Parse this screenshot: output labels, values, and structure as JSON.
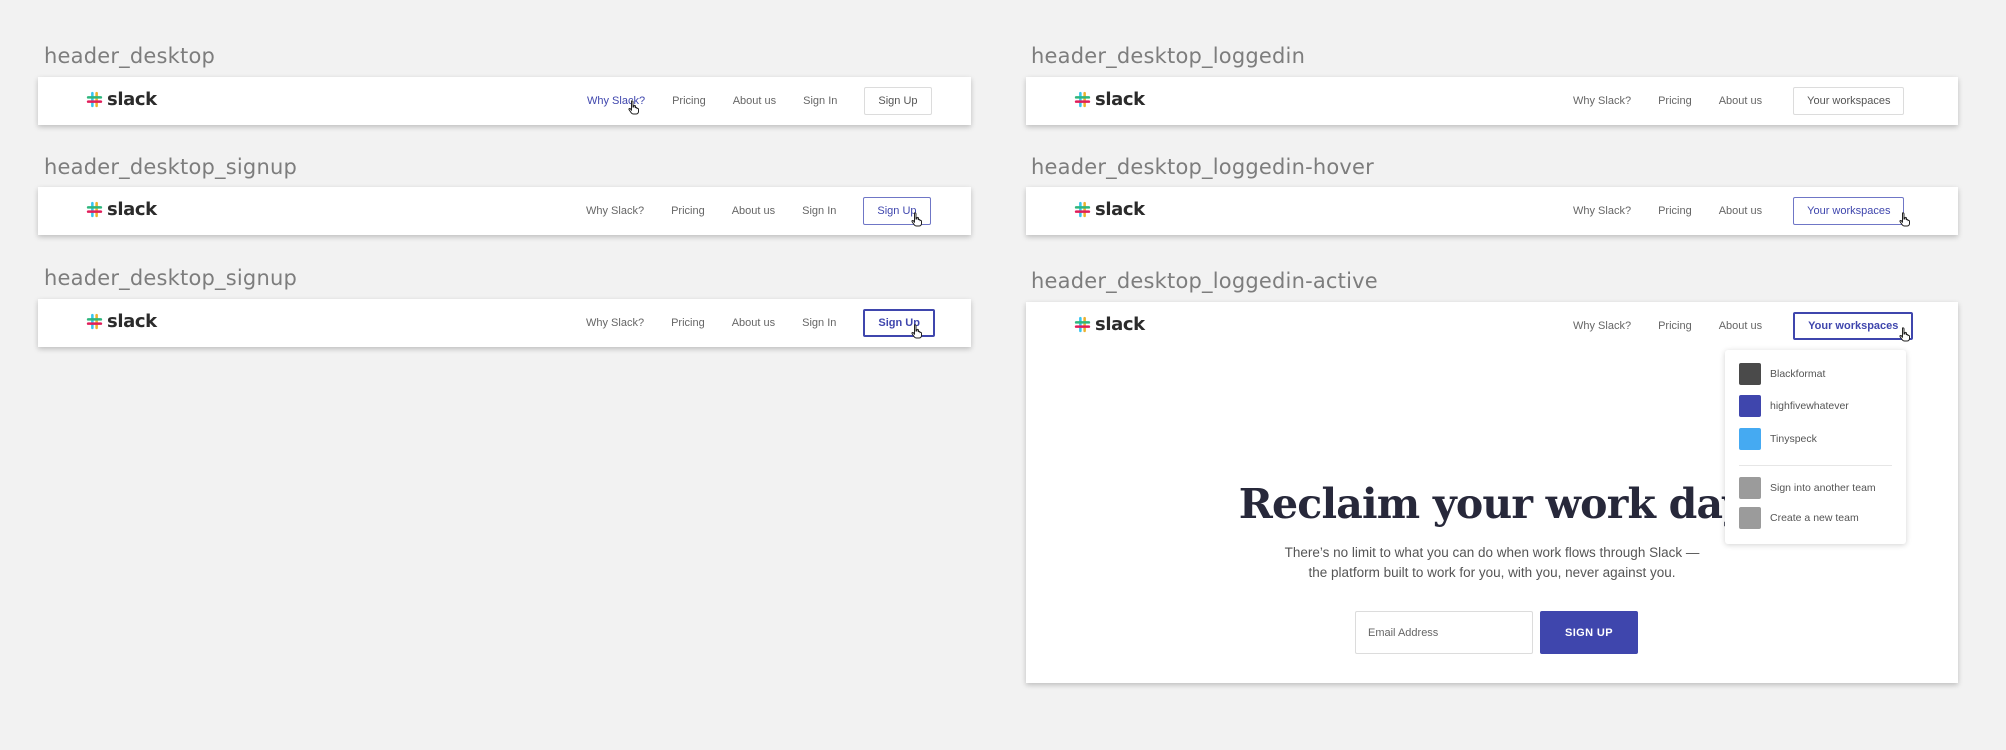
{
  "captions": {
    "left": [
      "header_desktop",
      "header_desktop_signup",
      "header_desktop_signup"
    ],
    "right": [
      "header_desktop_loggedin",
      "header_desktop_loggedin-hover",
      "header_desktop_loggedin-active"
    ]
  },
  "brand": {
    "name": "slack",
    "icon": "slack-hash-logo-icon",
    "colors": {
      "aqua": "#36c5f0",
      "green": "#2eb67d",
      "yellow": "#ecb22e",
      "red": "#e01e5a"
    }
  },
  "nav_public": {
    "why": "Why Slack?",
    "pricing": "Pricing",
    "about": "About us",
    "signin": "Sign In",
    "signup": "Sign Up"
  },
  "nav_loggedin": {
    "why": "Why Slack?",
    "pricing": "Pricing",
    "about": "About us",
    "workspaces": "Your workspaces"
  },
  "dropdown": {
    "teams": [
      {
        "name": "Blackformat",
        "color": "#4a4a4a"
      },
      {
        "name": "highfivewhatever",
        "color": "#3f46ad"
      },
      {
        "name": "Tinyspeck",
        "color": "#45aaf2"
      }
    ],
    "actions": [
      {
        "label": "Sign into another team",
        "color": "#9b9b9b"
      },
      {
        "label": "Create a new team",
        "color": "#9b9b9b"
      }
    ]
  },
  "hero": {
    "title": "Reclaim your work day",
    "subtitle_line1": "There’s no limit to what you can do when work flows through Slack —",
    "subtitle_line2": "the platform built to work for you, with you, never against you.",
    "email_placeholder": "Email Address",
    "cta_label": "SIGN UP"
  },
  "colors": {
    "accent": "#3f46ad",
    "background": "#f2f2f2",
    "hero_text": "#27283a"
  }
}
